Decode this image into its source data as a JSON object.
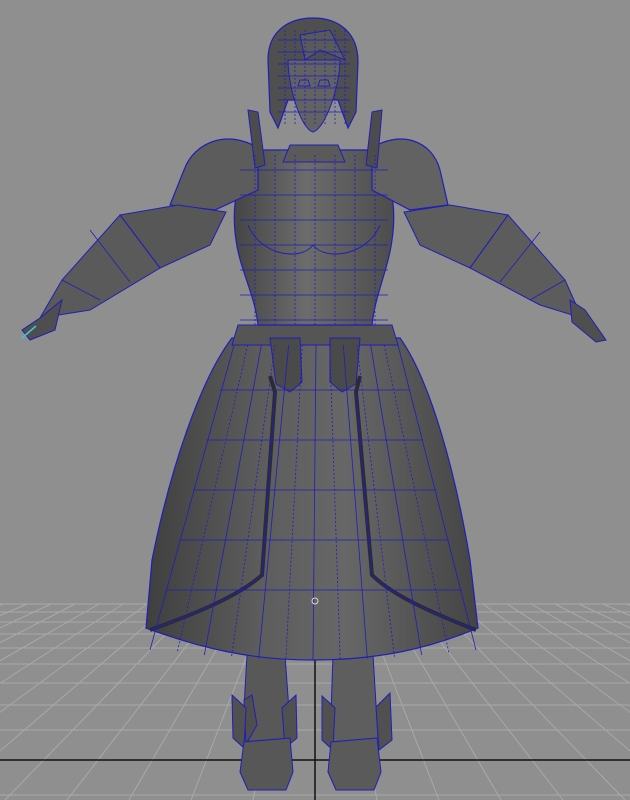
{
  "viewport": {
    "background_color": "#8f8f8f",
    "grid_visible": true,
    "grid_color": "#a9a9a9",
    "grid_axis_color": "#111111",
    "mesh_fill": "#636363",
    "mesh_shadow": "#3a3a3a",
    "wire_color": "#1f1fb8",
    "pivot_color": "#d8d8d8",
    "view": "front",
    "display_mode": "wireframe-on-shaded"
  },
  "model": {
    "icon": "character-mesh-icon",
    "selected_color": "#38c8d8"
  }
}
